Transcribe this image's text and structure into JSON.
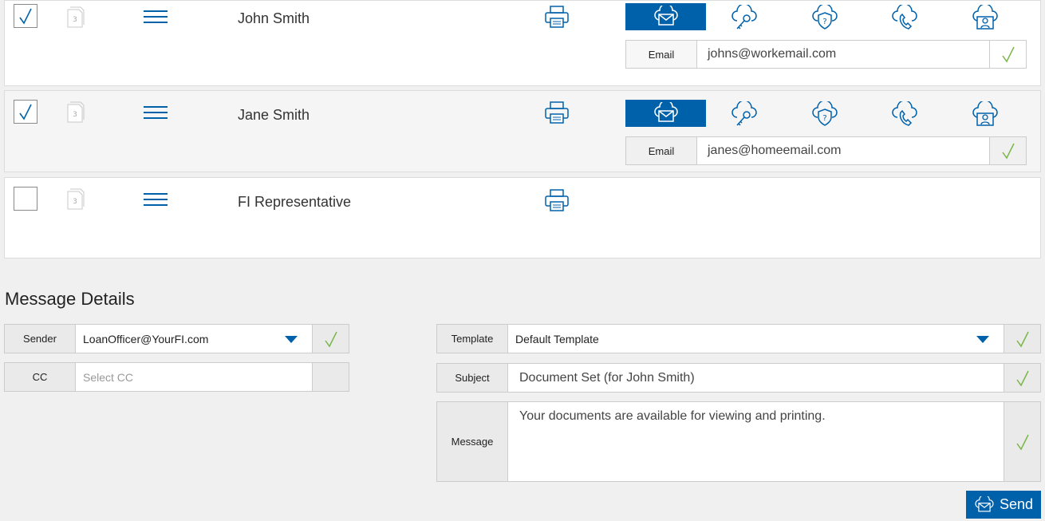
{
  "recipients": [
    {
      "name": "John Smith",
      "checked": true,
      "selected_channel": "email",
      "address_label": "Email",
      "address_value": "johns@workemail.com",
      "doc_count": "3"
    },
    {
      "name": "Jane Smith",
      "checked": true,
      "selected_channel": "email",
      "address_label": "Email",
      "address_value": "janes@homeemail.com",
      "doc_count": "3"
    },
    {
      "name": "FI Representative",
      "checked": false,
      "doc_count": "3"
    }
  ],
  "message_details": {
    "title": "Message Details",
    "sender": {
      "label": "Sender",
      "value": "LoanOfficer@YourFI.com"
    },
    "cc": {
      "label": "CC",
      "placeholder": "Select CC"
    },
    "template": {
      "label": "Template",
      "value": "Default Template"
    },
    "subject": {
      "label": "Subject",
      "value": "Document Set (for John Smith)"
    },
    "message": {
      "label": "Message",
      "value": "Your documents are available for viewing and printing."
    }
  },
  "send_button": {
    "label": "Send"
  },
  "icons": [
    "checkmark-icon",
    "document-count-icon",
    "menu-icon",
    "printer-icon",
    "cloud-mail-icon",
    "cloud-key-icon",
    "cloud-shield-question-icon",
    "cloud-phone-icon",
    "cloud-user-icon",
    "dropdown-caret-icon"
  ],
  "colors": {
    "accent": "#0061ab",
    "check_ok": "#7ab648",
    "background": "#f0f0f0"
  }
}
